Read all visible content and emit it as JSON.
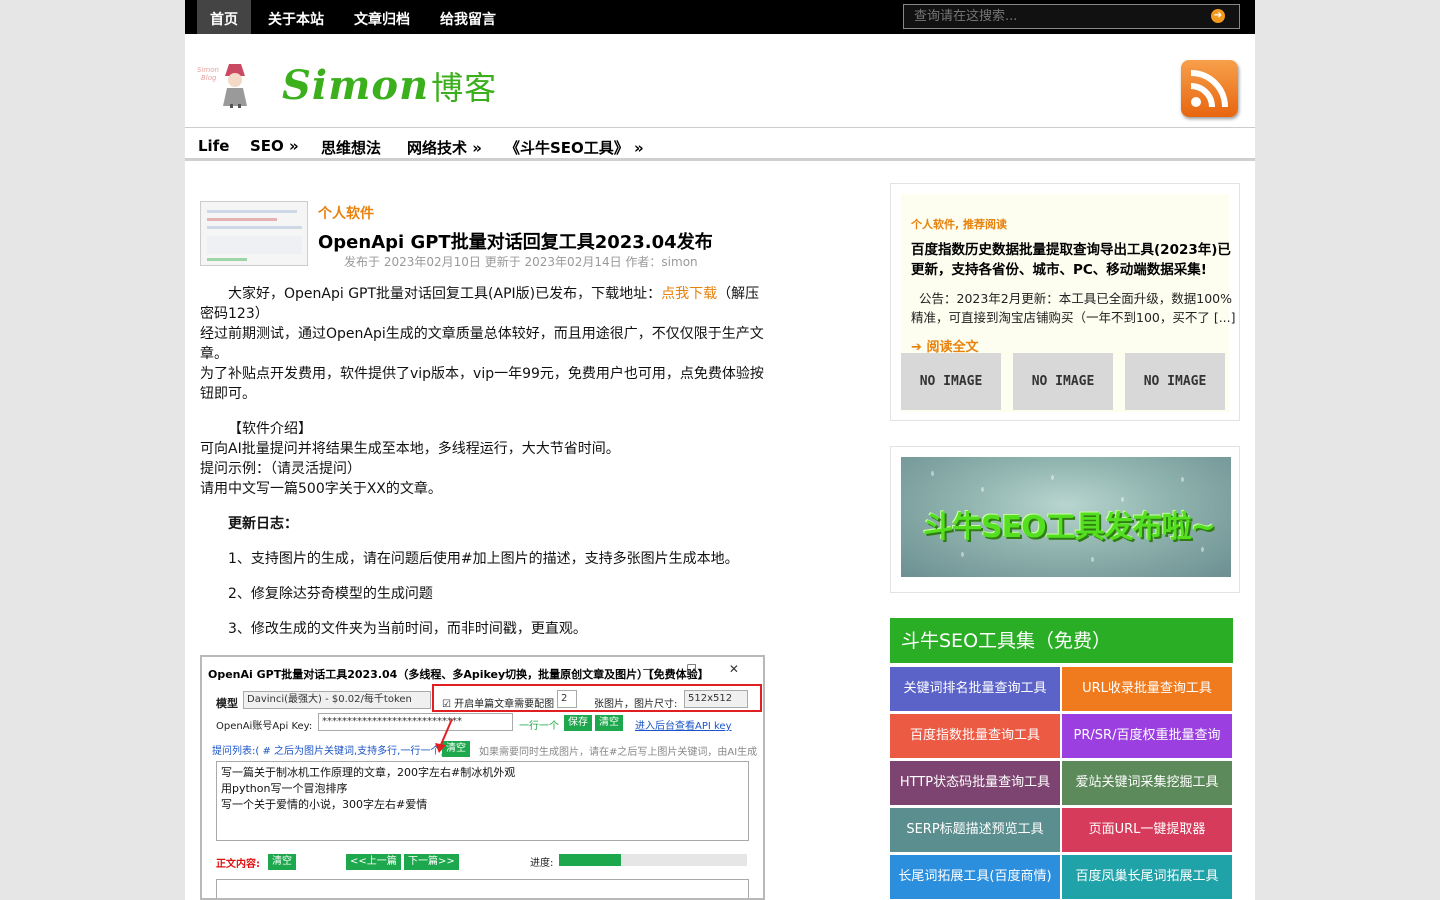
{
  "top_nav": {
    "items": [
      "首页",
      "关于本站",
      "文章归档",
      "给我留言"
    ]
  },
  "search": {
    "placeholder": "查询请在这搜索..."
  },
  "site": {
    "logo_latin": "Simon",
    "logo_cn": "博客",
    "mascot_text": "Simon Blog"
  },
  "category_nav": {
    "items": [
      "Life",
      "SEO »",
      "思维想法",
      "网络技术 »",
      "《斗牛SEO工具》 »"
    ]
  },
  "article": {
    "category": "个人软件",
    "title": "OpenApi GPT批量对话回复工具2023.04发布",
    "meta": "发布于 2023年02月10日 更新于 2023年02月14日  作者：simon",
    "p1_before": "大家好，OpenApi GPT批量对话回复工具(API版)已发布，下载地址：",
    "p1_link": "点我下载",
    "p1_after": "（解压密码123）",
    "p2": "经过前期测试，通过OpenApi生成的文章质量总体较好，而且用途很广，不仅仅限于生产文章。",
    "p3": "为了补贴点开发费用，软件提供了vip版本，vip一年99元，免费用户也可用，点免费体验按钮即可。",
    "intro_heading": "【软件介绍】",
    "intro_1": "可向AI批量提问并将结果生成至本地，多线程运行，大大节省时间。",
    "intro_2": "提问示例：（请灵活提问）",
    "intro_3": "请用中文写一篇500字关于XX的文章。",
    "changelog_heading": "更新日志：",
    "changelog": [
      "1、支持图片的生成，请在问题后使用#加上图片的描述，支持多张图片生成本地。",
      "2、修复除达芬奇模型的生成问题",
      "3、修改生成的文件夹为当前时间，而非时间戳，更直观。"
    ]
  },
  "screenshot": {
    "title": "OpenAi GPT批量对话工具2023.04（多线程、多Apikey切换，批量原创文章及图片）【免费体验】",
    "window_controls": "— ☐ ✕",
    "model_label": "模型",
    "model_value": "Davinci(最强大) - $0.02/每千token",
    "match_checkbox": "开启单篇文章需要配图",
    "image_count": "2",
    "image_label": "张图片，图片尺寸:",
    "image_size": "512x512",
    "apikey_label": "OpenAi账号Api Key:",
    "apikey_value": "****************************",
    "one_per_line": "一行一个",
    "save": "保存",
    "clear": "清空",
    "apikey_link": "进入后台查看API key",
    "question_list": "提问列表:(  # 之后为图片关键词,支持多行,一行一个)",
    "question_clear": "清空",
    "hint": "如果需要同时生成图片，请在#之后写上图片关键词，由AI生成",
    "questions": [
      "写一篇关于制冰机工作原理的文章，200字左右#制冰机外观",
      "用python写一个冒泡排序",
      "写一个关于爱情的小说，300字左右#爱情"
    ],
    "content_label": "正文内容:",
    "content_clear": "清空",
    "prev": "<<上一篇",
    "next": "下一篇>>",
    "progress_label": "进度:",
    "progress": 0.33
  },
  "sidebar": {
    "featured": {
      "cat1": "个人软件",
      "sep": ", ",
      "cat2": "推荐阅读",
      "title": "百度指数历史数据批量提取查询导出工具(2023年)已更新，支持各省份、城市、PC、移动端数据采集!",
      "excerpt": "公告：2023年2月更新：本工具已全面升级，数据100%精准，可直接到淘宝店铺购买（一年不到100，买不了 [...]",
      "readmore": "阅读全文",
      "no_image": [
        "NO IMAGE",
        "NO IMAGE",
        "NO IMAGE"
      ]
    },
    "banner_text": "斗牛SEO工具发布啦~",
    "tools_heading": "斗牛SEO工具集（免费）",
    "tools": [
      {
        "label": "关键词排名批量查询工具",
        "color": "#5b63c9"
      },
      {
        "label": "URL收录批量查询工具",
        "color": "#f07b1e"
      },
      {
        "label": "百度指数批量查询工具",
        "color": "#ec5a44"
      },
      {
        "label": "PR/SR/百度权重批量查询",
        "color": "#9b3fe0"
      },
      {
        "label": "HTTP状态码批量查询工具",
        "color": "#7d4472"
      },
      {
        "label": "爱站关键词采集挖掘工具",
        "color": "#5c8a5a"
      },
      {
        "label": "SERP标题描述预览工具",
        "color": "#5b8f8f"
      },
      {
        "label": "页面URL一键提取器",
        "color": "#d73b5c"
      },
      {
        "label": "长尾词拓展工具(百度商情)",
        "color": "#2c8fde"
      },
      {
        "label": "百度凤巢长尾词拓展工具",
        "color": "#1fa3a8"
      }
    ]
  }
}
